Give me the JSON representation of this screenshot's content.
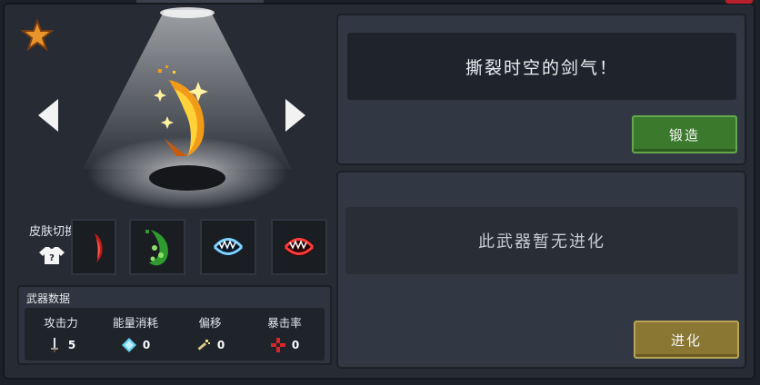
{
  "skins": {
    "label": "皮肤切换",
    "items": [
      "red-fang-skin",
      "green-slime-skin",
      "blue-jaw-skin",
      "red-jaw-skin"
    ]
  },
  "stats": {
    "title": "武器数据",
    "items": [
      {
        "label": "攻击力",
        "value": "5",
        "icon": "sword-icon"
      },
      {
        "label": "能量消耗",
        "value": "0",
        "icon": "energy-gem-icon"
      },
      {
        "label": "偏移",
        "value": "0",
        "icon": "offset-icon"
      },
      {
        "label": "暴击率",
        "value": "0",
        "icon": "crit-cross-icon"
      }
    ]
  },
  "weapon": {
    "description": "撕裂时空的剑气！",
    "forge_label": "锻造"
  },
  "evolution": {
    "status": "此武器暂无进化",
    "evolve_label": "进化"
  },
  "colors": {
    "forge_button": "#3b7a2c",
    "evolve_button": "#8a7733",
    "accent_star": "#e8962c"
  }
}
